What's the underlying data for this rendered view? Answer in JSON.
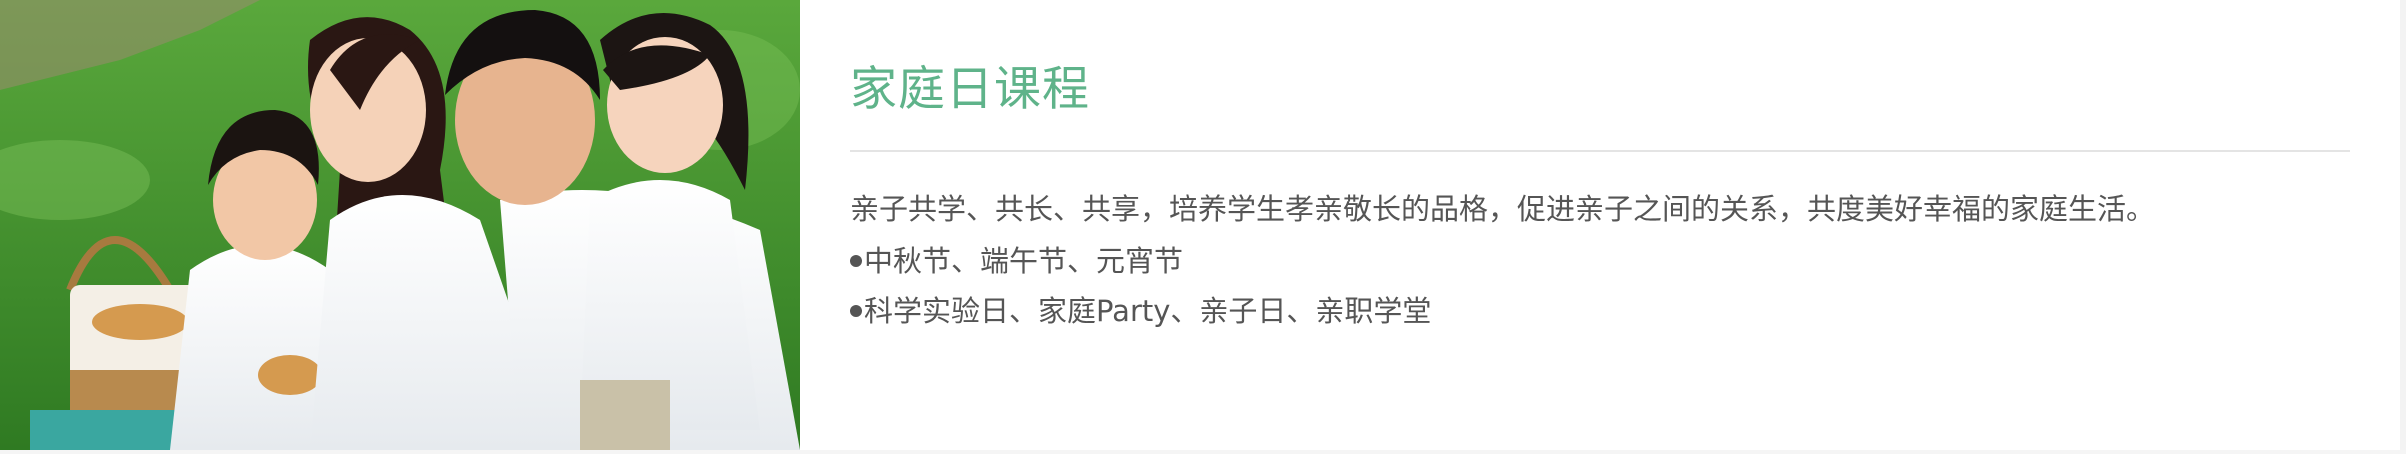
{
  "section": {
    "title": "家庭日课程",
    "description": "亲子共学、共长、共享，培养学生孝亲敬长的品格，促进亲子之间的关系，共度美好幸福的家庭生活。",
    "items": [
      {
        "label": "中秋节、端午节、元宵节"
      },
      {
        "label": "科学实验日、家庭Party、亲子日、亲职学堂"
      }
    ]
  },
  "photo": {
    "subject": "family-picnic-photo"
  },
  "colors": {
    "title": "#5fb38a",
    "body_text": "#555555",
    "divider": "#e4e4e4",
    "grass": "#3f8f2f"
  }
}
